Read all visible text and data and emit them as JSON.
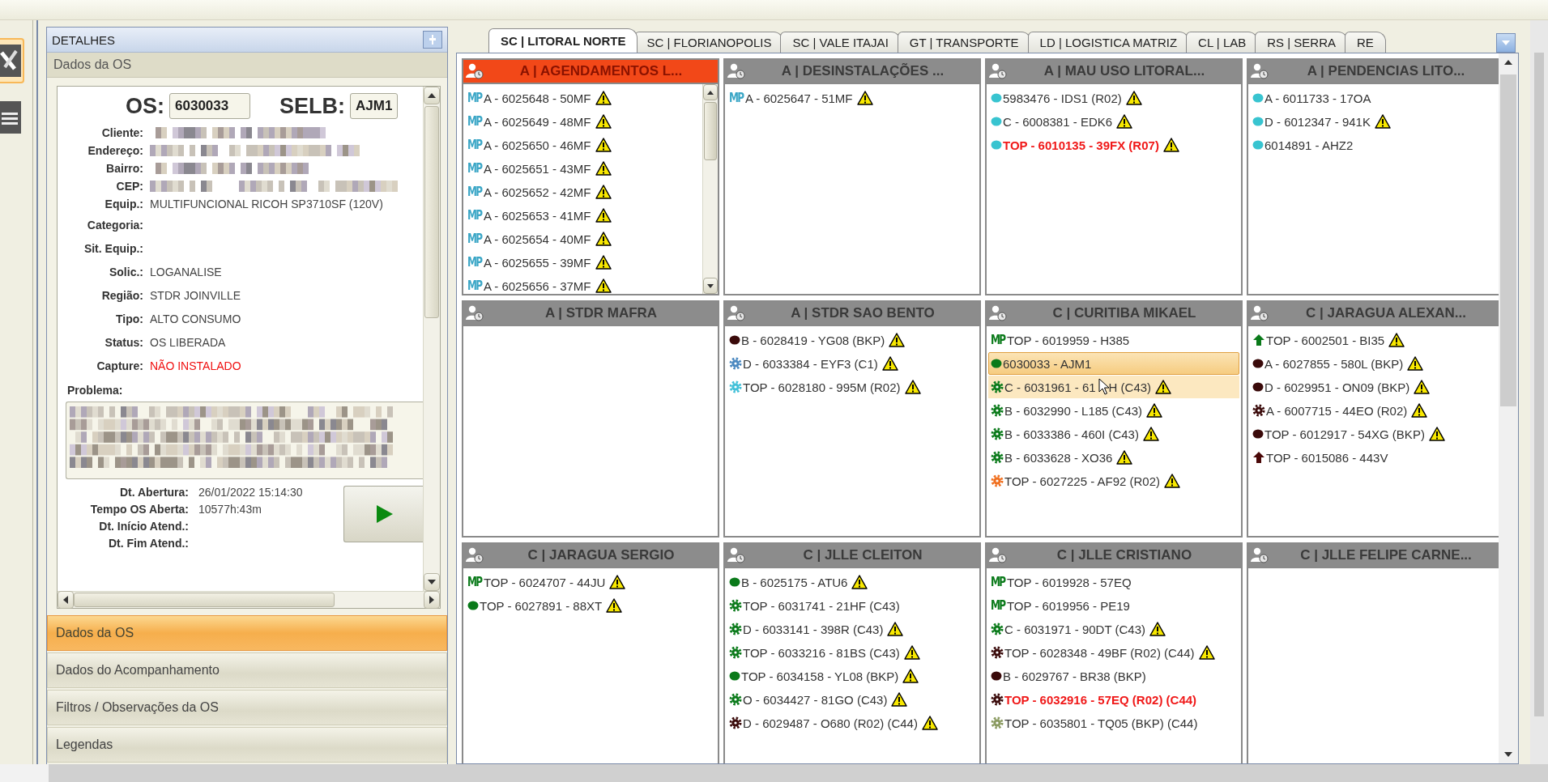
{
  "sidebar_icons": [
    {
      "kind": "tools",
      "selected": true
    },
    {
      "kind": "checklist",
      "selected": false
    }
  ],
  "details": {
    "title": "DETALHES",
    "section": "Dados da OS",
    "os_label": "OS:",
    "os_value": "6030033",
    "selb_label": "SELB:",
    "selb_value": "AJM1",
    "fields": [
      {
        "label": "Cliente:",
        "kind": "blurred"
      },
      {
        "label": "Endereço:",
        "kind": "blurred"
      },
      {
        "label": "Bairro:",
        "kind": "blurred"
      },
      {
        "label": "CEP:",
        "kind": "blurred_pair"
      },
      {
        "label": "Equip.:",
        "kind": "text",
        "value": "MULTIFUNCIONAL RICOH SP3710SF (120V)",
        "alert": false
      },
      {
        "label": "Categoria:",
        "kind": "empty"
      },
      {
        "label": "Sit. Equip.:",
        "kind": "empty"
      },
      {
        "label": "Solic.:",
        "kind": "text",
        "value": "LOGANALISE",
        "alert": false
      },
      {
        "label": "Região:",
        "kind": "text",
        "value": "STDR JOINVILLE",
        "alert": false
      },
      {
        "label": "Tipo:",
        "kind": "text",
        "value": "ALTO CONSUMO",
        "alert": false
      },
      {
        "label": "Status:",
        "kind": "text",
        "value": "OS LIBERADA",
        "alert": false
      },
      {
        "label": "Capture:",
        "kind": "text",
        "value": "NÃO INSTALADO",
        "alert": true
      }
    ],
    "problem_label": "Problema:",
    "dates": [
      {
        "label": "Dt. Abertura:",
        "value": "26/01/2022 15:14:30"
      },
      {
        "label": "Tempo OS Aberta:",
        "value": "10577h:43m"
      },
      {
        "label": "Dt. Início Atend.:"
      },
      {
        "label": "Dt. Fim Atend.:"
      }
    ]
  },
  "accordion": [
    {
      "label": "Dados da OS",
      "selected": true
    },
    {
      "label": "Dados do Acompanhamento",
      "selected": false
    },
    {
      "label": "Filtros / Observações da OS",
      "selected": false
    },
    {
      "label": "Legendas",
      "selected": false
    }
  ],
  "tabs": [
    {
      "label": "SC | LITORAL NORTE",
      "selected": true
    },
    {
      "label": "SC | FLORIANOPOLIS",
      "selected": false
    },
    {
      "label": "SC | VALE ITAJAI",
      "selected": false
    },
    {
      "label": "GT | TRANSPORTE",
      "selected": false
    },
    {
      "label": "LD | LOGISTICA MATRIZ",
      "selected": false
    },
    {
      "label": "CL | LAB",
      "selected": false
    },
    {
      "label": "RS | SERRA",
      "selected": false
    },
    {
      "label": "RE",
      "selected": false
    }
  ],
  "cards": [
    {
      "title": "A | AGENDAMENTOS L...",
      "selected": true,
      "scrollable": true,
      "items": [
        {
          "kind": "mp",
          "tag": "MP",
          "color": "#3aa6c6",
          "text": "A - 6025648 - 50MF",
          "warning": true,
          "alert": false,
          "selected": false,
          "hovered": false
        },
        {
          "kind": "mp",
          "tag": "MP",
          "color": "#3aa6c6",
          "text": "A - 6025649 - 48MF",
          "warning": true,
          "alert": false,
          "selected": false,
          "hovered": false
        },
        {
          "kind": "mp",
          "tag": "MP",
          "color": "#3aa6c6",
          "text": "A - 6025650 - 46MF",
          "warning": true,
          "alert": false,
          "selected": false,
          "hovered": false
        },
        {
          "kind": "mp",
          "tag": "MP",
          "color": "#3aa6c6",
          "text": "A - 6025651 - 43MF",
          "warning": true,
          "alert": false,
          "selected": false,
          "hovered": false
        },
        {
          "kind": "mp",
          "tag": "MP",
          "color": "#3aa6c6",
          "text": "A - 6025652 - 42MF",
          "warning": true,
          "alert": false,
          "selected": false,
          "hovered": false
        },
        {
          "kind": "mp",
          "tag": "MP",
          "color": "#3aa6c6",
          "text": "A - 6025653 - 41MF",
          "warning": true,
          "alert": false,
          "selected": false,
          "hovered": false
        },
        {
          "kind": "mp",
          "tag": "MP",
          "color": "#3aa6c6",
          "text": "A - 6025654 - 40MF",
          "warning": true,
          "alert": false,
          "selected": false,
          "hovered": false
        },
        {
          "kind": "mp",
          "tag": "MP",
          "color": "#3aa6c6",
          "text": "A - 6025655 - 39MF",
          "warning": true,
          "alert": false,
          "selected": false,
          "hovered": false
        },
        {
          "kind": "mp",
          "tag": "MP",
          "color": "#3aa6c6",
          "text": "A - 6025656 - 37MF",
          "warning": true,
          "alert": false,
          "selected": false,
          "hovered": false
        }
      ]
    },
    {
      "title": "A | DESINSTALAÇÕES ...",
      "selected": false,
      "scrollable": false,
      "items": [
        {
          "kind": "mp",
          "tag": "MP",
          "color": "#3aa6c6",
          "text": "A - 6025647 - 51MF",
          "warning": true,
          "alert": false,
          "selected": false,
          "hovered": false
        }
      ]
    },
    {
      "title": "A | MAU USO LITORAL...",
      "selected": false,
      "scrollable": false,
      "items": [
        {
          "kind": "dot",
          "color": "#38c4d0",
          "text": "5983476 - IDS1 (R02)",
          "warning": true,
          "alert": false,
          "selected": false,
          "hovered": false
        },
        {
          "kind": "dot",
          "color": "#38c4d0",
          "text": "C - 6008381 - EDK6",
          "warning": true,
          "alert": false,
          "selected": false,
          "hovered": false
        },
        {
          "kind": "dot",
          "color": "#38c4d0",
          "text": "TOP - 6010135 - 39FX (R07)",
          "warning": true,
          "alert": true,
          "selected": false,
          "hovered": false
        }
      ]
    },
    {
      "title": "A | PENDENCIAS LITO...",
      "selected": false,
      "scrollable": false,
      "items": [
        {
          "kind": "dot",
          "color": "#38c4d0",
          "text": "A - 6011733 - 17OA",
          "warning": false,
          "alert": false,
          "selected": false,
          "hovered": false
        },
        {
          "kind": "dot",
          "color": "#38c4d0",
          "text": "D - 6012347 - 941K",
          "warning": true,
          "alert": false,
          "selected": false,
          "hovered": false
        },
        {
          "kind": "dot",
          "color": "#38c4d0",
          "text": "6014891 - AHZ2",
          "warning": false,
          "alert": false,
          "selected": false,
          "hovered": false
        }
      ]
    },
    {
      "title": "A | STDR MAFRA",
      "selected": false,
      "scrollable": false
    },
    {
      "title": "A | STDR SAO BENTO",
      "selected": false,
      "scrollable": false,
      "items": [
        {
          "kind": "dot",
          "color": "#3a0a0a",
          "text": "B - 6028419 - YG08 (BKP)",
          "warning": true,
          "alert": false,
          "selected": false,
          "hovered": false
        },
        {
          "kind": "gear",
          "color": "#4a88c0",
          "text": "D - 6033384 - EYF3 (C1)",
          "warning": true,
          "alert": false,
          "selected": false,
          "hovered": false
        },
        {
          "kind": "gear",
          "color": "#40c0d8",
          "text": "TOP - 6028180 - 995M (R02)",
          "warning": true,
          "alert": false,
          "selected": false,
          "hovered": false
        }
      ]
    },
    {
      "title": "C | CURITIBA MIKAEL",
      "selected": false,
      "scrollable": false,
      "items": [
        {
          "kind": "mp",
          "tag": "MP",
          "color": "#0a7a1a",
          "text": "TOP - 6019959 - H385",
          "warning": false,
          "alert": false,
          "selected": false,
          "hovered": false
        },
        {
          "kind": "dot",
          "color": "#0a7a1a",
          "text": "6030033 - AJM1",
          "warning": false,
          "alert": false,
          "selected": true,
          "hovered": false
        },
        {
          "kind": "gear",
          "color": "#0a7a1a",
          "text": "C - 6031961 - 61",
          "text_after": "H (C43)",
          "warning": true,
          "alert": false,
          "selected": false,
          "hovered": true
        },
        {
          "kind": "gear",
          "color": "#0a7a1a",
          "text": "B - 6032990 - L185 (C43)",
          "warning": true,
          "alert": false,
          "selected": false,
          "hovered": false
        },
        {
          "kind": "gear",
          "color": "#0a7a1a",
          "text": "B - 6033386 - 460I (C43)",
          "warning": true,
          "alert": false,
          "selected": false,
          "hovered": false
        },
        {
          "kind": "gear",
          "color": "#0a7a1a",
          "text": "B - 6033628 - XO36",
          "warning": true,
          "alert": false,
          "selected": false,
          "hovered": false
        },
        {
          "kind": "gear",
          "color": "#f07020",
          "text": "TOP - 6027225 - AF92 (R02)",
          "warning": true,
          "alert": false,
          "selected": false,
          "hovered": false
        }
      ]
    },
    {
      "title": "C | JARAGUA ALEXAN...",
      "selected": false,
      "scrollable": false,
      "items": [
        {
          "kind": "arrow",
          "color": "#0a7a1a",
          "text": "TOP - 6002501 - BI35",
          "warning": true,
          "alert": false,
          "selected": false,
          "hovered": false
        },
        {
          "kind": "dot",
          "color": "#3a0a0a",
          "text": "A - 6027855 - 580L (BKP)",
          "warning": true,
          "alert": false,
          "selected": false,
          "hovered": false
        },
        {
          "kind": "dot",
          "color": "#3a0a0a",
          "text": "D - 6029951 - ON09 (BKP)",
          "warning": true,
          "alert": false,
          "selected": false,
          "hovered": false
        },
        {
          "kind": "gear",
          "color": "#3a0a0a",
          "text": "A - 6007715 - 44EO (R02)",
          "warning": true,
          "alert": false,
          "selected": false,
          "hovered": false
        },
        {
          "kind": "dot",
          "color": "#3a0a0a",
          "text": "TOP - 6012917 - 54XG (BKP)",
          "warning": true,
          "alert": false,
          "selected": false,
          "hovered": false
        },
        {
          "kind": "arrow",
          "color": "#4a0808",
          "text": "TOP - 6015086 - 443V",
          "warning": false,
          "alert": false,
          "selected": false,
          "hovered": false
        }
      ]
    },
    {
      "title": "C | JARAGUA SERGIO",
      "selected": false,
      "scrollable": false,
      "items": [
        {
          "kind": "mp",
          "tag": "MP",
          "color": "#0a7a1a",
          "text": "TOP - 6024707 - 44JU",
          "warning": true,
          "alert": false,
          "selected": false,
          "hovered": false
        },
        {
          "kind": "dot",
          "color": "#0a7a1a",
          "text": "TOP - 6027891 - 88XT",
          "warning": true,
          "alert": false,
          "selected": false,
          "hovered": false
        }
      ]
    },
    {
      "title": "C | JLLE CLEITON",
      "selected": false,
      "scrollable": false,
      "items": [
        {
          "kind": "dot",
          "color": "#0a7a1a",
          "text": "B - 6025175 - ATU6",
          "warning": true,
          "alert": false,
          "selected": false,
          "hovered": false
        },
        {
          "kind": "gear",
          "color": "#0a7a1a",
          "text": "TOP - 6031741 - 21HF (C43)",
          "warning": false,
          "alert": false,
          "selected": false,
          "hovered": false
        },
        {
          "kind": "gear",
          "color": "#0a7a1a",
          "text": "D - 6033141 - 398R (C43)",
          "warning": true,
          "alert": false,
          "selected": false,
          "hovered": false
        },
        {
          "kind": "gear",
          "color": "#0a7a1a",
          "text": "TOP - 6033216 - 81BS (C43)",
          "warning": true,
          "alert": false,
          "selected": false,
          "hovered": false
        },
        {
          "kind": "dot",
          "color": "#0a7a1a",
          "text": "TOP - 6034158 - YL08 (BKP)",
          "warning": true,
          "alert": false,
          "selected": false,
          "hovered": false
        },
        {
          "kind": "gear",
          "color": "#0a7a1a",
          "text": "O - 6034427 - 81GO (C43)",
          "warning": true,
          "alert": false,
          "selected": false,
          "hovered": false
        },
        {
          "kind": "gear",
          "color": "#3a0a0a",
          "text": "D - 6029487 - O680 (R02) (C44)",
          "warning": true,
          "alert": false,
          "selected": false,
          "hovered": false
        }
      ]
    },
    {
      "title": "C | JLLE CRISTIANO",
      "selected": false,
      "scrollable": false,
      "items": [
        {
          "kind": "mp",
          "tag": "MP",
          "color": "#0a7a1a",
          "text": "TOP - 6019928 - 57EQ",
          "warning": false,
          "alert": false,
          "selected": false,
          "hovered": false
        },
        {
          "kind": "mp",
          "tag": "MP",
          "color": "#0a7a1a",
          "text": "TOP - 6019956 - PE19",
          "warning": false,
          "alert": false,
          "selected": false,
          "hovered": false
        },
        {
          "kind": "gear",
          "color": "#0a7a1a",
          "text": "C - 6031971 - 90DT (C43)",
          "warning": true,
          "alert": false,
          "selected": false,
          "hovered": false
        },
        {
          "kind": "gear",
          "color": "#3a0a0a",
          "text": "TOP - 6028348 - 49BF (R02) (C44)",
          "warning": true,
          "alert": false,
          "selected": false,
          "hovered": false
        },
        {
          "kind": "dot",
          "color": "#3a0a0a",
          "text": "B - 6029767 - BR38 (BKP)",
          "warning": false,
          "alert": false,
          "selected": false,
          "hovered": false
        },
        {
          "kind": "gear",
          "color": "#3a0a0a",
          "text": "TOP - 6032916 - 57EQ (R02) (C44)",
          "warning": false,
          "alert": true,
          "selected": false,
          "hovered": false
        },
        {
          "kind": "gear",
          "color": "#8a9a60",
          "text": "TOP - 6035801 - TQ05 (BKP) (C44)",
          "warning": false,
          "alert": false,
          "selected": false,
          "hovered": false
        }
      ]
    },
    {
      "title": "C | JLLE FELIPE CARNE...",
      "selected": false,
      "scrollable": false
    }
  ]
}
